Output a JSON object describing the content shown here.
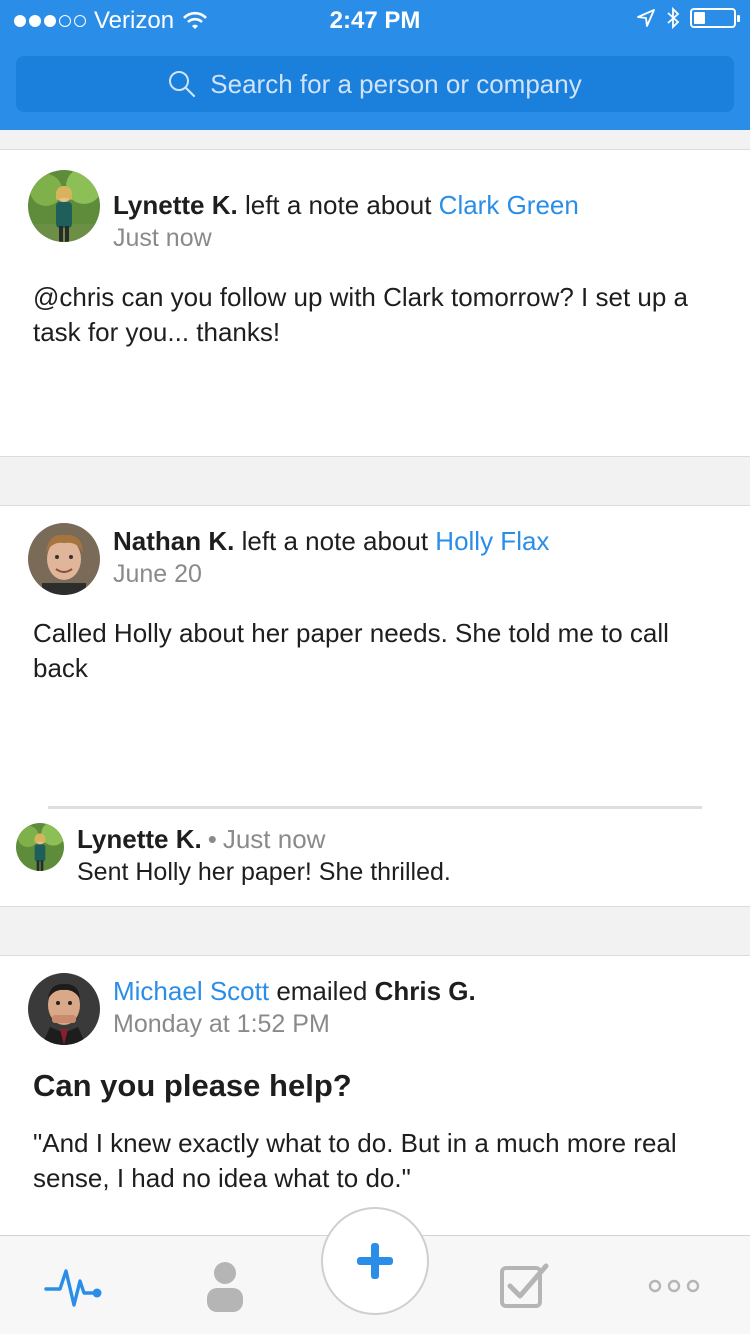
{
  "status_bar": {
    "carrier": "Verizon",
    "time": "2:47 PM",
    "battery_level": 0.3
  },
  "search": {
    "placeholder": "Search for a person or company"
  },
  "feed": [
    {
      "author": "Lynette K.",
      "action": "left a note about",
      "subject": "Clark Green",
      "time": "Just now",
      "body": "@chris can you follow up with Clark tomorrow? I set up a task for you... thanks!"
    },
    {
      "author": "Nathan K.",
      "action": "left a note about",
      "subject": "Holly Flax",
      "time": "June 20",
      "body": "Called Holly about her paper needs. She told me to call back",
      "reply": {
        "author": "Lynette K.",
        "time": "Just now",
        "body": "Sent Holly her paper! She thrilled."
      }
    },
    {
      "author": "Michael Scott",
      "action": "emailed",
      "recipient": "Chris G.",
      "time": "Monday at 1:52 PM",
      "title": "Can you please help?",
      "body": "\"And I knew exactly what to do. But in a much more real sense, I had no idea what to do.\""
    }
  ],
  "tabs": [
    {
      "icon": "activity-pulse-icon",
      "active": true
    },
    {
      "icon": "person-icon",
      "active": false
    },
    {
      "icon": "plus-icon",
      "active": false
    },
    {
      "icon": "checkbox-icon",
      "active": false
    },
    {
      "icon": "more-dots-icon",
      "active": false
    }
  ],
  "colors": {
    "brand_blue": "#2a8ee9",
    "search_bg": "#1b7fdc",
    "muted_text": "#8a8a8a",
    "tab_inactive": "#b5b5b5"
  }
}
